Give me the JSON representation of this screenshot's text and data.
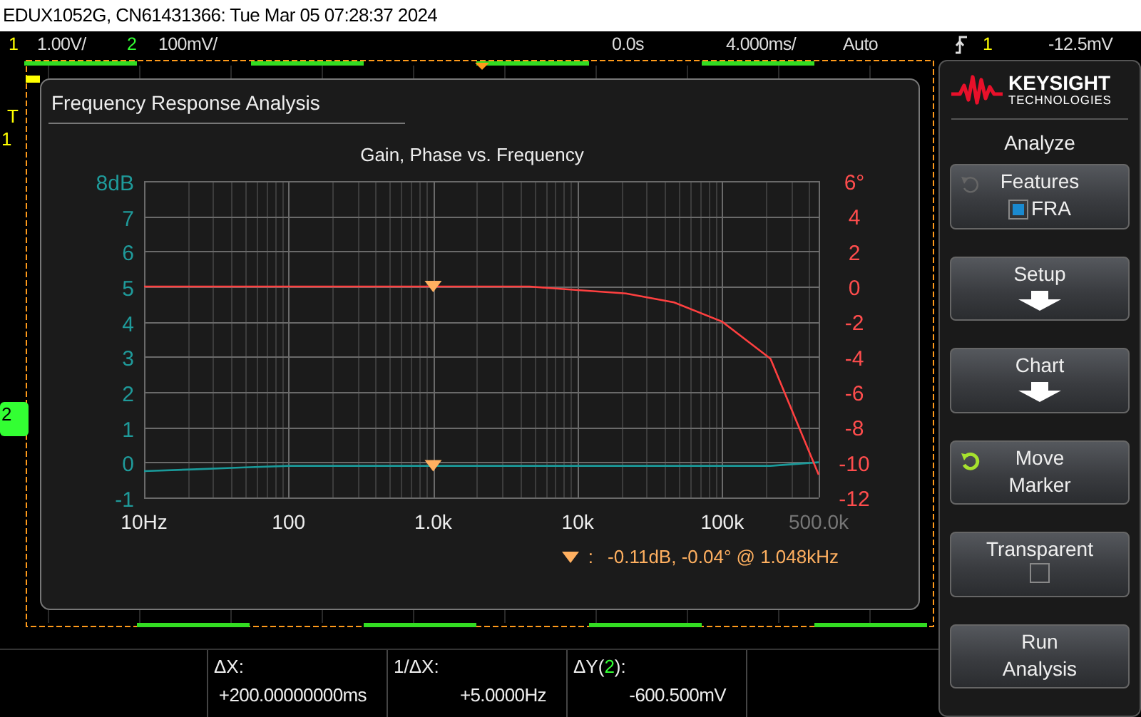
{
  "window": {
    "title": "EDUX1052G, CN61431366: Tue Mar 05 07:28:37 2024"
  },
  "status_bar": {
    "channels": [
      {
        "number": "1",
        "scale": "1.00V/",
        "color": "#ffff00"
      },
      {
        "number": "2",
        "scale": "100mV/",
        "color": "#33ff33"
      }
    ],
    "delay": "0.0s",
    "timebase": "4.000ms/",
    "trigger_mode": "Auto",
    "trigger_source": {
      "number": "1",
      "color": "#ffff00"
    },
    "trigger_level": "-12.5mV"
  },
  "channel_markers": [
    {
      "number": "1",
      "color": "#ffff00",
      "trigger": "T"
    },
    {
      "number": "2",
      "color": "#33ff33"
    }
  ],
  "dialog": {
    "title": "Frequency Response Analysis",
    "chart_data": {
      "type": "line",
      "title": "Gain, Phase vs. Frequency",
      "categories": [
        "10Hz",
        null,
        null,
        "100",
        null,
        null,
        "1.0k",
        null,
        null,
        "10k",
        null,
        null,
        "100k",
        null,
        "500.0k"
      ],
      "series": [
        {
          "color": "#1a9a9a",
          "values": [
            -0.25,
            -0.2,
            -0.15,
            -0.1,
            -0.1,
            -0.1,
            -0.1,
            -0.1,
            -0.1,
            -0.1,
            -0.1,
            -0.1,
            -0.1,
            -0.1,
            0
          ]
        },
        {
          "color": "#ff4040",
          "axis": "y2",
          "values": [
            0,
            0,
            0,
            0,
            0,
            0,
            0,
            0,
            0,
            -0.2,
            -0.4,
            -0.9,
            -2.0,
            -4.1,
            -10.7
          ]
        }
      ],
      "ylim": [
        -1,
        8
      ],
      "y2lim": [
        -12,
        6
      ],
      "yticks": [
        {
          "value": 8,
          "label": "8dB"
        },
        7,
        6,
        5,
        4,
        3,
        2,
        1,
        0,
        -1
      ],
      "y2ticks": [
        {
          "value": 6,
          "label": "6°"
        },
        4,
        2,
        0,
        -2,
        -4,
        -6,
        -8,
        -10,
        -12
      ],
      "grid": true,
      "annotations": [
        {
          "x": "1.0k"
        }
      ]
    },
    "readout": {
      "separator": ":",
      "text": "-0.11dB, -0.04° @ 1.048kHz"
    }
  },
  "measurements": [
    {
      "label": "ΔX:",
      "value": "+200.00000000ms"
    },
    {
      "label": "1/ΔX:",
      "value": "+5.0000Hz"
    },
    {
      "label": "ΔY(",
      "channel": "2",
      "label_end": "):",
      "color": "#33ff33",
      "value": "-600.500mV"
    }
  ],
  "side_panel": {
    "logo": {
      "name": "KEYSIGHT",
      "tagline": "TECHNOLOGIES"
    },
    "title": "Analyze",
    "buttons": [
      {
        "kind": "knob",
        "label": "Features",
        "knob_active": false,
        "checkbox": {
          "label": "FRA",
          "checked": true
        }
      },
      {
        "kind": "submenu",
        "label": "Setup"
      },
      {
        "kind": "submenu",
        "label": "Chart"
      },
      {
        "kind": "knob",
        "label": "Move\nMarker",
        "knob_active": true
      },
      {
        "kind": "toggle",
        "label": "Transparent",
        "checkbox": {
          "checked": false
        }
      },
      {
        "kind": "action",
        "label": "Run\nAnalysis"
      }
    ]
  }
}
